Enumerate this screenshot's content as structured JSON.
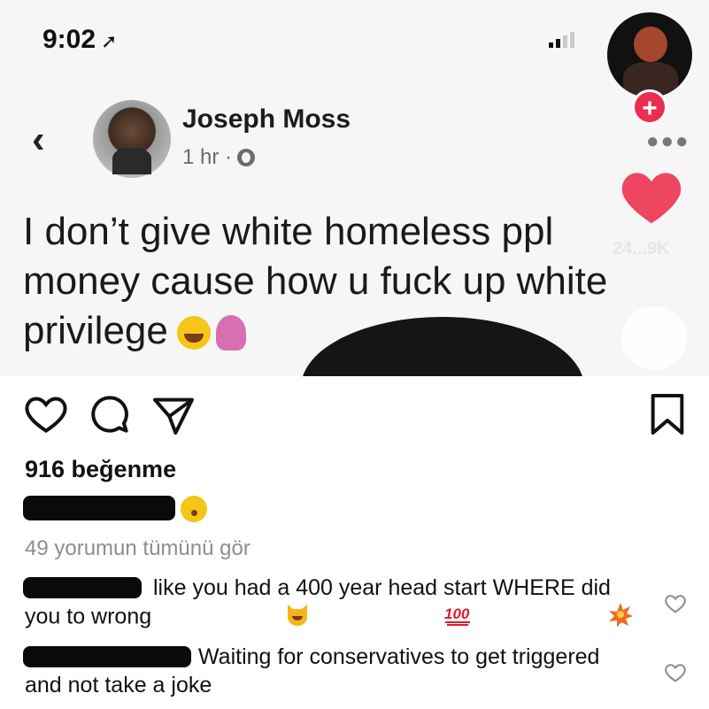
{
  "screenshot": {
    "status_time": "9:02",
    "poster_name": "Joseph Moss",
    "poster_time": "1 hr ·",
    "post_text": "I don’t give white homeless ppl money cause how u fuck up white privilege",
    "like_count_overlay": "24...9K",
    "icons": [
      "location-arrow-icon",
      "signal-icon",
      "back-chevron-icon",
      "globe-icon",
      "plus-icon",
      "more-dots-icon",
      "heart-icon",
      "comment-bubble-icon"
    ]
  },
  "post": {
    "likes_label": "916 beğenme",
    "view_all_comments": "49 yorumun tümünü gör",
    "comments": [
      {
        "text": "like you had a 400 year head start WHERE did you to wrong",
        "emojis": [
          "laughing-cat-emoji",
          "hundred-points-emoji",
          "collision-emoji"
        ]
      },
      {
        "text": "Waiting for conservatives to get triggered and not take a joke",
        "emojis": []
      }
    ],
    "icons": [
      "like-heart-icon",
      "comment-icon",
      "share-icon",
      "bookmark-icon",
      "comment-like-icon"
    ]
  },
  "colors": {
    "accent_red": "#ec2d4f",
    "heart_red": "#ee4560",
    "text": "#111111",
    "muted": "#8e8e8e"
  }
}
